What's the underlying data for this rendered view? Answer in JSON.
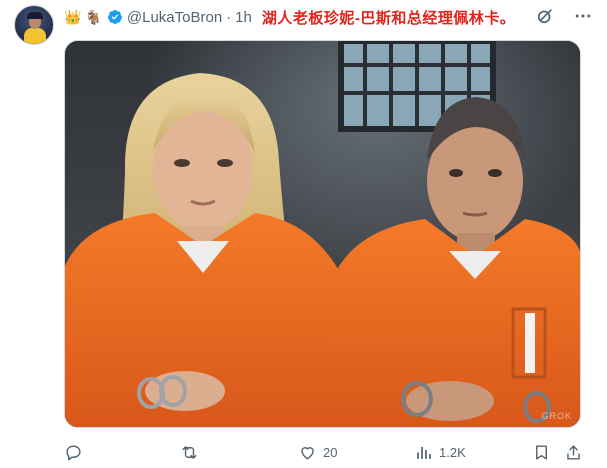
{
  "tweet": {
    "emojis": [
      "👑",
      "🐐"
    ],
    "handle": "@LukaToBron",
    "separator": "·",
    "time": "1h",
    "text": "湖人老板珍妮-巴斯和总经理佩林卡。",
    "watermark": "GROK"
  },
  "top_icons": [
    "grok-icon",
    "more-icon"
  ],
  "actions": {
    "reply_count": "",
    "retweet_count": "",
    "like_count": "20",
    "views_count": "1.2K"
  },
  "colors": {
    "text_secondary": "#536471",
    "verified": "#1d9bf0",
    "tweet_text": "#e0241b",
    "jumpsuit": "#ee6a1e"
  }
}
